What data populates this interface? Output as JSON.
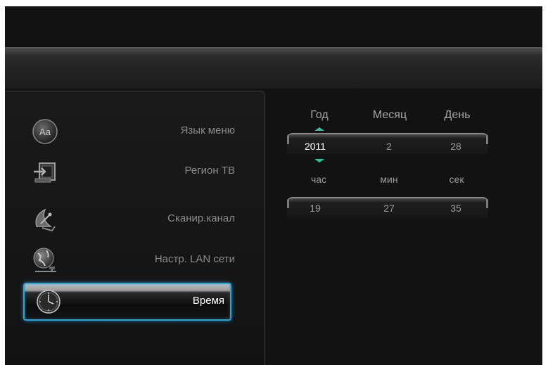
{
  "menu": {
    "items": [
      {
        "label": "Язык меню",
        "icon": "language-aa-icon"
      },
      {
        "label": "Регион ТВ",
        "icon": "tv-region-icon"
      },
      {
        "label": "Сканир.канал",
        "icon": "satellite-dish-icon"
      },
      {
        "label": "Настр. LAN сети",
        "icon": "globe-network-icon"
      },
      {
        "label": "Время",
        "icon": "clock-icon",
        "selected": true
      }
    ]
  },
  "datetime": {
    "date_headers": {
      "year": "Год",
      "month": "Месяц",
      "day": "День"
    },
    "date_values": {
      "year": "2011",
      "month": "2",
      "day": "28"
    },
    "time_headers": {
      "hour": "час",
      "minute": "мин",
      "second": "сек"
    },
    "time_values": {
      "hour": "19",
      "minute": "27",
      "second": "35"
    }
  },
  "colors": {
    "accent": "#2ea3d6",
    "arrow": "#2ec4a0",
    "background": "#121212"
  }
}
